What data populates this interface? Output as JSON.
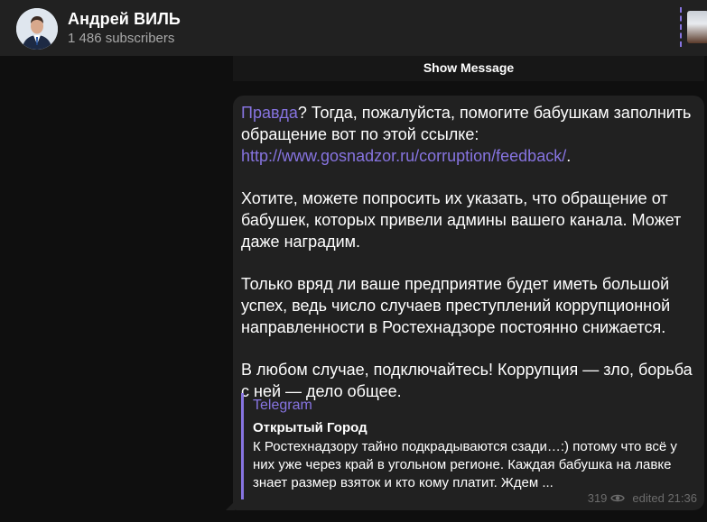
{
  "header": {
    "channel_title": "Андрей ВИЛЬ",
    "subscribers": "1 486 subscribers"
  },
  "show_message": "Show Message",
  "message": {
    "link_word": "Правда",
    "p1_rest": "? Тогда, пожалуйста, помогите бабушкам заполнить обращение вот по этой ссылке: ",
    "url": "http://www.gosnadzor.ru/corruption/feedback/",
    "url_suffix": ".",
    "p2": "Хотите, можете попросить их указать, что обращение от бабушек, которых привели админы вашего канала. Может даже наградим.",
    "p3": "Только вряд ли ваше предприятие будет иметь большой успех, ведь число случаев преступлений коррупционной направленности в Ростехнадзоре постоянно снижается.",
    "p4": "В любом случае, подключайтесь! Коррупция — зло, борьба с ней — дело общее.",
    "preview": {
      "site": "Telegram",
      "title": "Открытый Город",
      "description": "К Ростехнадзору тайно подкрадываются сзади…:) потому что всё у них уже через край в угольном регионе. Каждая бабушка на лавке знает размер взяток и кто кому платит. Ждем ..."
    },
    "views": "319",
    "edited_time": "edited 21:36"
  },
  "colors": {
    "accent": "#8774e1",
    "background": "#0f0f0f",
    "bubble": "#212121"
  },
  "icons": {
    "views": "eye-icon"
  }
}
